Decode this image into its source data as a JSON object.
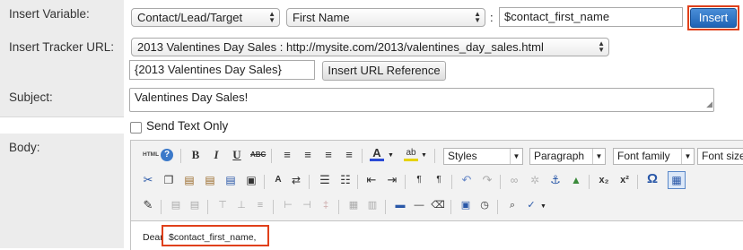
{
  "labels": {
    "insert_variable": "Insert Variable:",
    "insert_tracker_url": "Insert Tracker URL:",
    "subject": "Subject:",
    "body": "Body:"
  },
  "insert_variable": {
    "module_select": "Contact/Lead/Target",
    "field_select": "First Name",
    "separator": ":",
    "variable_value": "$contact_first_name",
    "insert_button": "Insert"
  },
  "tracker": {
    "url_select": "2013 Valentines Day Sales : http://mysite.com/2013/valentines_day_sales.html",
    "name_value": "{2013 Valentines Day Sales}",
    "insert_ref_button": "Insert URL Reference"
  },
  "subject": {
    "value": "Valentines Day Sales!"
  },
  "send_text_only": {
    "label": "Send Text Only",
    "checked": false
  },
  "editor": {
    "html_button": "HTML",
    "styles_select": "Styles",
    "format_select": "Paragraph",
    "font_family_select": "Font family",
    "font_size_select": "Font size",
    "content_prefix": "Dear ",
    "content_variable": "$contact_first_name,",
    "icons_row1": [
      "help-icon",
      "bold-icon",
      "italic-icon",
      "underline-icon",
      "strikethrough-icon",
      "align-left-icon",
      "align-center-icon",
      "align-right-icon",
      "align-justify-icon",
      "text-color-icon",
      "highlight-color-icon"
    ],
    "icons_row2": [
      "cut-icon",
      "copy-icon",
      "paste-icon",
      "paste-text-icon",
      "paste-word-icon",
      "find-icon",
      "replace-icon",
      "bullet-list-icon",
      "numbered-list-icon",
      "outdent-icon",
      "indent-icon",
      "ltr-icon",
      "rtl-icon",
      "undo-icon",
      "redo-icon",
      "link-icon",
      "unlink-icon",
      "anchor-icon",
      "image-icon",
      "subscript-icon",
      "superscript-icon",
      "special-char-icon",
      "table-icon"
    ],
    "icons_row3": [
      "edit-css-icon",
      "row-props-icon",
      "cell-props-icon",
      "insert-row-before-icon",
      "insert-row-after-icon",
      "delete-row-icon",
      "insert-col-before-icon",
      "insert-col-after-icon",
      "delete-col-icon",
      "split-cells-icon",
      "merge-cells-icon",
      "horizontal-rule-icon",
      "line-icon",
      "remove-format-icon",
      "insert-date-icon",
      "insert-time-icon",
      "preview-icon",
      "spellcheck-icon"
    ]
  }
}
